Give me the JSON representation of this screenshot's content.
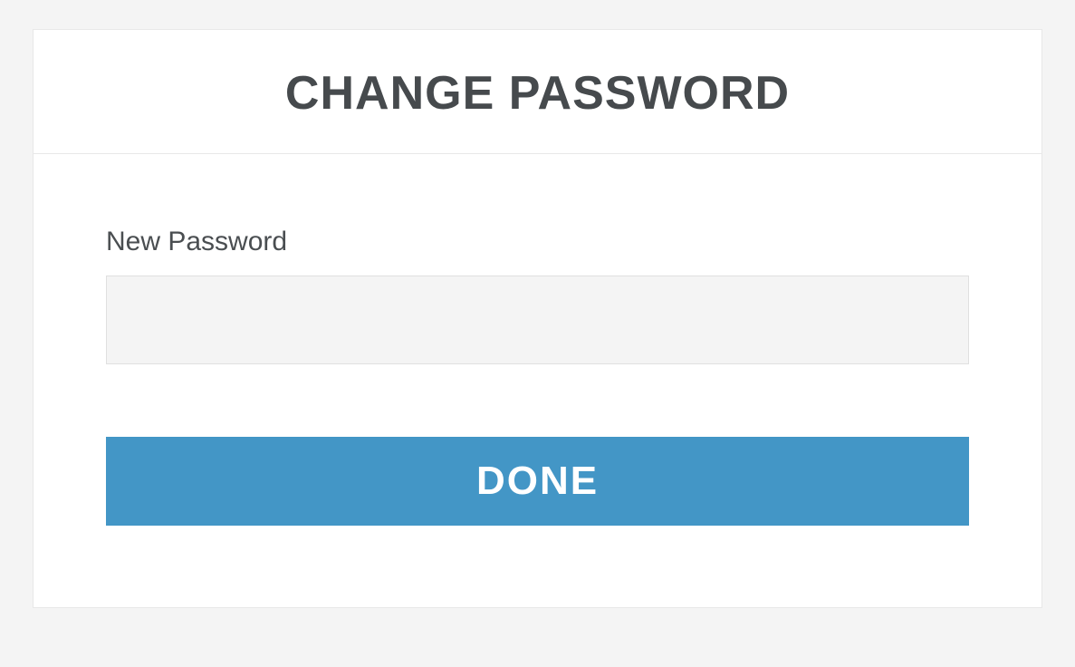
{
  "header": {
    "title": "CHANGE PASSWORD"
  },
  "form": {
    "new_password": {
      "label": "New Password",
      "value": ""
    },
    "submit_label": "DONE"
  }
}
